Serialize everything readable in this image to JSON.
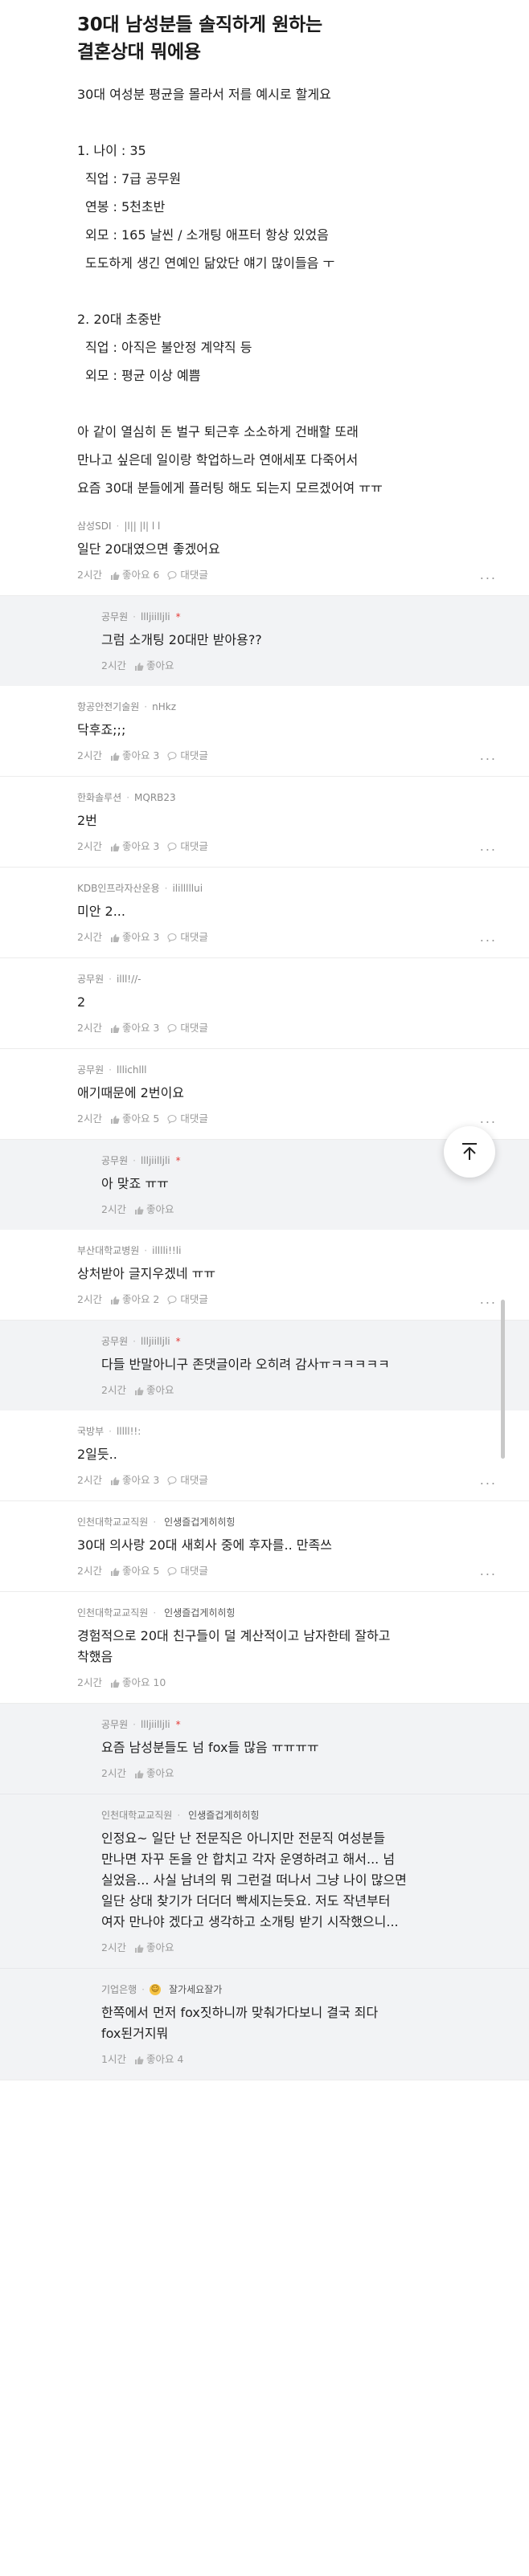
{
  "post": {
    "title_line1": "30대 남성분들 솔직하게 원하는",
    "title_line2": "결혼상대 뭐에용",
    "intro": "30대 여성분 평균을 몰라서 저를 예시로 할게요",
    "sec1_title": "1. 나이 : 35",
    "sec1_job": "직업 : 7급 공무원",
    "sec1_salary": "연봉 : 5천초반",
    "sec1_look1": "외모 : 165 날씬 / 소개팅 애프터 항상 있었음",
    "sec1_look2": "도도하게 생긴 연예인 닮았단 얘기 많이들음 ㅜ",
    "sec2_title": "2. 20대 초중반",
    "sec2_job": "직업 : 아직은 불안정 계약직 등",
    "sec2_look": "외모 : 평균 이상 예쁨",
    "outro1": "아 같이 열심히 돈 벌구 퇴근후 소소하게 건배할 또래",
    "outro2": "만나고 싶은데 일이랑 학업하느라 연애세포 다죽어서",
    "outro3": "요즘 30대 분들에게 플러팅 해도 되는지 모르겠어여 ㅠㅠ"
  },
  "comments": [
    {
      "company": "삼성SDI",
      "nick": "|l|| |l| l l",
      "text": "일단 20대였으면 좋겠어요",
      "time": "2시간",
      "like": "좋아요 6",
      "reply": "대댓글"
    },
    {
      "company": "공무원",
      "nick": "llljiilljli",
      "author": "*",
      "text": "그럼 소개팅 20대만 받아용??",
      "time": "2시간",
      "like": "좋아요"
    },
    {
      "company": "항공안전기술원",
      "nick": "nHkz",
      "text": "닥후죠;;;",
      "time": "2시간",
      "like": "좋아요 3",
      "reply": "대댓글"
    },
    {
      "company": "한화솔루션",
      "nick": "MQRB23",
      "text": "2번",
      "time": "2시간",
      "like": "좋아요 3",
      "reply": "대댓글"
    },
    {
      "company": "KDB인프라자산운용",
      "nick": "ililllllui",
      "text": "미안 2...",
      "time": "2시간",
      "like": "좋아요 3",
      "reply": "대댓글"
    },
    {
      "company": "공무원",
      "nick": "illl!//-",
      "text": "2",
      "time": "2시간",
      "like": "좋아요 3",
      "reply": "대댓글"
    },
    {
      "company": "공무원",
      "nick": "lllichlll",
      "text": "애기때문에 2번이요",
      "time": "2시간",
      "like": "좋아요 5",
      "reply": "대댓글"
    },
    {
      "company": "공무원",
      "nick": "llljiilljli",
      "author": "*",
      "text": "아 맞죠 ㅠㅠ",
      "time": "2시간",
      "like": "좋아요"
    },
    {
      "company": "부산대학교병원",
      "nick": "illlli!!li",
      "text": "상처받아 글지우겠네 ㅠㅠ",
      "time": "2시간",
      "like": "좋아요 2",
      "reply": "대댓글"
    },
    {
      "company": "공무원",
      "nick": "llljiilljli",
      "author": "*",
      "text": "다들 반말아니구 존댓글이라 오히려 감사ㅠㅋㅋㅋㅋㅋ",
      "time": "2시간",
      "like": "좋아요"
    },
    {
      "company": "국방부",
      "nick": "lllll!!:",
      "text": "2일듯..",
      "time": "2시간",
      "like": "좋아요 3",
      "reply": "대댓글"
    },
    {
      "company": "인천대학교교직원",
      "nick": "인생즐겁게히히힝",
      "text": "30대 의사랑 20대 새회사 중에 후자를.. 만족쓰",
      "time": "2시간",
      "like": "좋아요 5",
      "reply": "대댓글"
    },
    {
      "company": "인천대학교교직원",
      "nick": "인생즐겁게히히힝",
      "text1": "경험적으로 20대 친구들이 덜 계산적이고 남자한테 잘하고",
      "text2": "착했음",
      "time": "2시간",
      "like": "좋아요 10"
    },
    {
      "company": "공무원",
      "nick": "llljiilljli",
      "author": "*",
      "text": "요즘 남성분들도 넘 fox들 많음 ㅠㅠㅠㅠ",
      "time": "2시간",
      "like": "좋아요"
    },
    {
      "company": "인천대학교교직원",
      "nick": "인생즐겁게히히힝",
      "text1": "인정요~ 일단 난 전문직은 아니지만 전문직 여성분들",
      "text2": "만나면 자꾸 돈을 안 합치고 각자 운영하려고 해서... 넘",
      "text3": "실었음... 사실 남녀의 뭐 그런걸 떠나서 그냥 나이 많으면",
      "text4": "일단 상대 찾기가 더더더 빡세지는듯요. 저도 작년부터",
      "text5": "여자 만나야 겠다고 생각하고 소개팅 받기 시작했으니...",
      "time": "2시간",
      "like": "좋아요"
    },
    {
      "company": "기업은행",
      "nick": "잘가세요잘가",
      "text1": "한쪽에서 먼저 fox짓하니까 맞춰가다보니 결국 죄다",
      "text2": "fox된거지뭐",
      "time": "1시간",
      "like": "좋아요 4"
    }
  ],
  "more_label": "...",
  "fab_icon": "arrow-up-icon"
}
